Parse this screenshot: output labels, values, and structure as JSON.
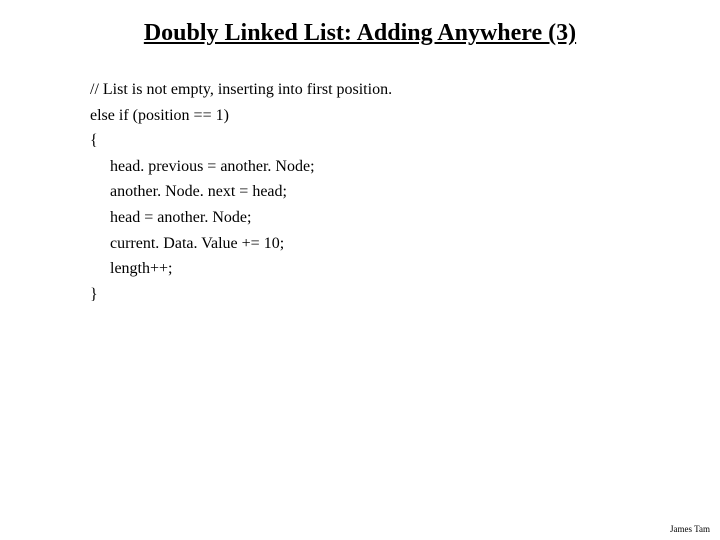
{
  "title": "Doubly Linked List: Adding Anywhere (3)",
  "code": {
    "l1": "// List is not empty, inserting into first position.",
    "l2": "else if (position == 1)",
    "l3": "{",
    "l4": "head. previous = another. Node;",
    "l5": "another. Node. next = head;",
    "l6": "head = another. Node;",
    "l7": "current. Data. Value += 10;",
    "l8": "length++;",
    "l9": "}"
  },
  "footer": "James Tam"
}
